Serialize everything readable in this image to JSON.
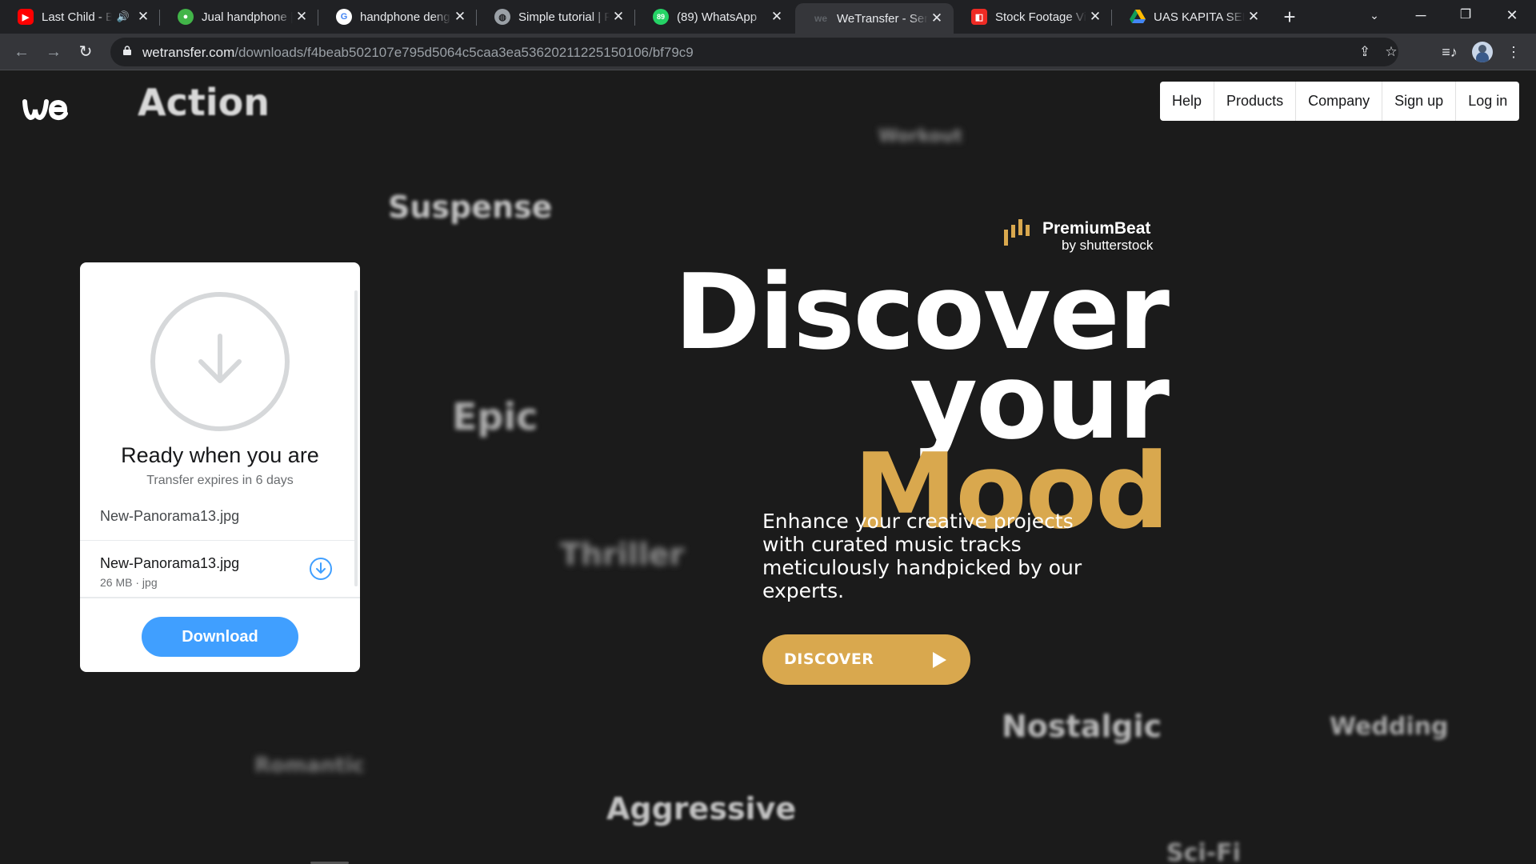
{
  "browser": {
    "tabs": [
      {
        "title": "Last Child - Bu",
        "favicon": "youtube-icon",
        "audio": true
      },
      {
        "title": "Jual handphone |",
        "favicon": "tokopedia-icon"
      },
      {
        "title": "handphone deng",
        "favicon": "google-icon"
      },
      {
        "title": "Simple tutorial | F",
        "favicon": "globe-icon"
      },
      {
        "title": "(89) WhatsApp",
        "favicon": "whatsapp-icon",
        "badge": "89"
      },
      {
        "title": "WeTransfer - Send",
        "favicon": "wetransfer-icon",
        "active": true
      },
      {
        "title": "Stock Footage Vid",
        "favicon": "shutterstock-icon"
      },
      {
        "title": "UAS KAPITA SELE",
        "favicon": "google-drive-icon"
      }
    ],
    "url_domain": "wetransfer.com",
    "url_path": "/downloads/f4beab502107e795d5064c5caa3ea53620211225150106/bf79c9"
  },
  "nav": {
    "help": "Help",
    "products": "Products",
    "company": "Company",
    "signup": "Sign up",
    "login": "Log in"
  },
  "moods": {
    "action": "Action",
    "workout": "Workout",
    "suspense": "Suspense",
    "epic": "Epic",
    "thriller": "Thriller",
    "nostalgic": "Nostalgic",
    "wedding": "Wedding",
    "romantic": "Romantic",
    "aggressive": "Aggressive",
    "scifi": "Sci-Fi"
  },
  "card": {
    "title": "Ready when you are",
    "expires": "Transfer expires in 6 days",
    "header_file": "New-Panorama13.jpg",
    "file": {
      "name": "New-Panorama13.jpg",
      "size": "26 MB",
      "type": "jpg"
    },
    "download_label": "Download"
  },
  "ad": {
    "brand": "PremiumBeat",
    "brand_sub": "by shutterstock",
    "headline_line1": "Discover",
    "headline_line2_a": "your ",
    "headline_line2_b": "Mood",
    "body": "Enhance your creative projects with curated music tracks meticulously handpicked by our experts.",
    "cta": "DISCOVER"
  },
  "colors": {
    "accent_gold": "#d9a84e",
    "download_blue": "#409fff",
    "page_bg": "#1b1b1b"
  }
}
